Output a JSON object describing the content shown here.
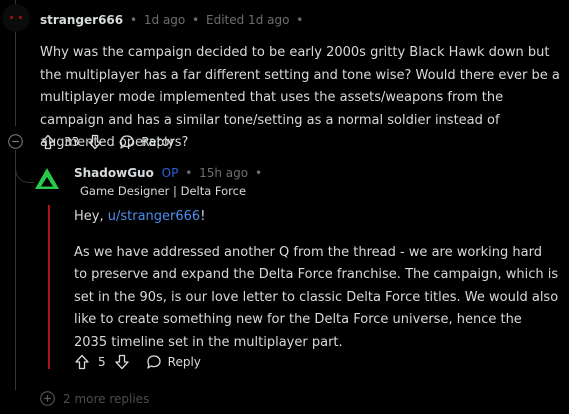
{
  "comment": {
    "username": "stranger666",
    "time": "1d ago",
    "edited": "Edited 1d ago",
    "text": "Why was the campaign decided to be early 2000s gritty Black Hawk down but the multiplayer has a far different setting and tone wise? Would there ever be a multiplayer mode implemented that uses the assets/weapons from the campaign and has a similar tone/setting as a normal soldier instead of augmented operators?",
    "votes": "33",
    "reply_label": "Reply",
    "bullet": "•"
  },
  "reply": {
    "username": "ShadowGuo",
    "op_badge": "OP",
    "time": "15h ago",
    "flair": "Game Designer | Delta Force",
    "greeting_prefix": "Hey, ",
    "greeting_link": "u/stranger666",
    "greeting_suffix": "!",
    "text": "As we have addressed another Q from the thread - we are working hard to preserve and expand the Delta Force franchise. The campaign, which is set in the 90s, is our love letter to classic Delta Force titles. We would also like to create something new for the Delta Force universe, hence the 2035 timeline set in the multiplayer part.",
    "votes": "5",
    "reply_label": "Reply",
    "bullet": "•"
  },
  "more_replies": "2 more replies",
  "colors": {
    "accent_link": "#4f8df0",
    "op_blue": "#2a63d8",
    "thread_red": "#a8141a",
    "logo_green": "#28c84a"
  }
}
